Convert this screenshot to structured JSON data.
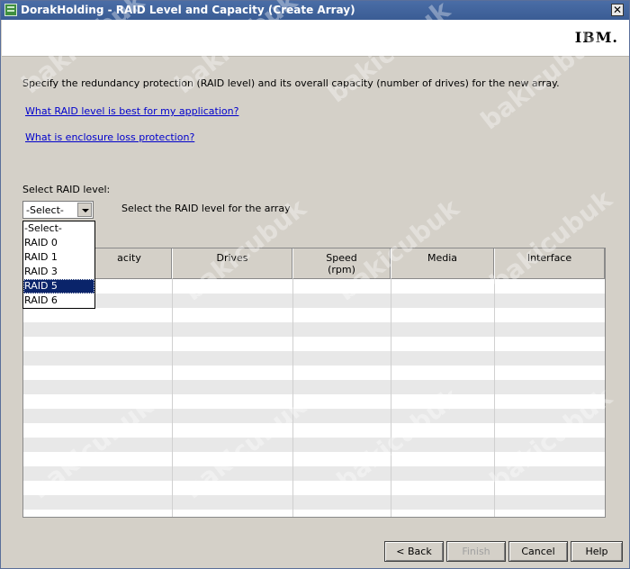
{
  "window": {
    "title": "DorakHolding - RAID Level and Capacity (Create Array)",
    "close_glyph": "✕",
    "logo": "IBM."
  },
  "main": {
    "instruction": "Specify the redundancy protection (RAID level) and its overall capacity (number of drives) for the new array.",
    "link_raid_level": "What RAID level is best for my application?",
    "link_enclosure": "What is enclosure loss protection?",
    "select_label": "Select RAID level:",
    "select_value": "-Select-",
    "select_hint": "Select the RAID level for the array"
  },
  "dropdown": {
    "options": [
      "-Select-",
      "RAID 0",
      "RAID 1",
      "RAID 3",
      "RAID 5",
      "RAID 6"
    ],
    "highlighted": "RAID 5"
  },
  "table": {
    "columns": [
      "Capacity",
      "Drives",
      "Speed\n(rpm)",
      "Media",
      "Interface"
    ],
    "visible_columns": [
      "acity",
      "Drives",
      "Speed",
      "(rpm)",
      "Media",
      "Interface"
    ],
    "rows": []
  },
  "buttons": {
    "back": "< Back",
    "finish": "Finish",
    "cancel": "Cancel",
    "help": "Help"
  },
  "watermark": "bakicubuk",
  "colors": {
    "titlebar": "#3a5c94",
    "dialog_bg": "#d4d0c8",
    "link": "#0000cc",
    "selection": "#0a246a"
  }
}
